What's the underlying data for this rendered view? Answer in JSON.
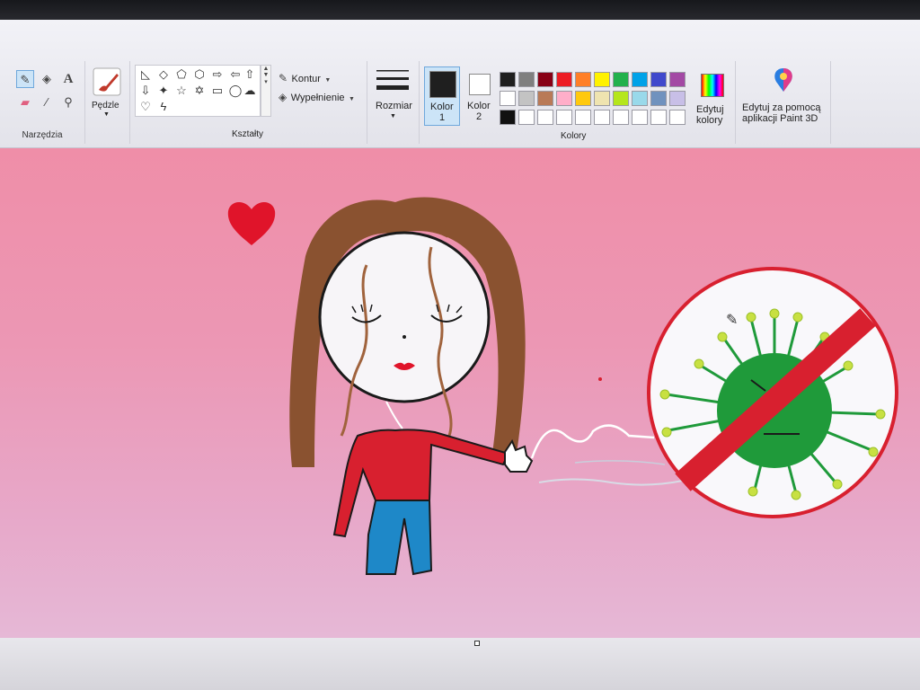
{
  "ribbon": {
    "tools_label": "Narzędzia",
    "brushes_label": "Pędzle",
    "shapes_label": "Kształty",
    "outline_label": "Kontur",
    "fill_label": "Wypełnienie",
    "size_label": "Rozmiar",
    "color1_label": "Kolor",
    "color1_num": "1",
    "color2_label": "Kolor",
    "color2_num": "2",
    "colors_label": "Kolory",
    "edit_colors_line1": "Edytuj",
    "edit_colors_line2": "kolory",
    "paint3d_line1": "Edytuj za pomocą",
    "paint3d_line2": "aplikacji Paint 3D",
    "text_tool_glyph": "A"
  },
  "palette": {
    "row1": [
      "#1f1f1f",
      "#7f7f7f",
      "#880015",
      "#ed1c24",
      "#ff7f27",
      "#fff200",
      "#22b14c",
      "#00a2e8",
      "#3f48cc",
      "#a349a4"
    ],
    "row2": [
      "#ffffff",
      "#c3c3c3",
      "#b97a57",
      "#ffaec9",
      "#ffc90e",
      "#efe4b0",
      "#b5e61d",
      "#99d9ea",
      "#7092be",
      "#c8bfe7"
    ],
    "row3": [
      "#111111",
      "#ffffff",
      "#ffffff",
      "#ffffff",
      "#ffffff",
      "#ffffff",
      "#ffffff",
      "#ffffff",
      "#ffffff",
      "#ffffff"
    ],
    "color1": "#1f1f1f",
    "color2": "#ffffff"
  },
  "icons": {
    "pencil": "pencil-icon",
    "fill": "fill-bucket-icon",
    "text": "text-icon",
    "eraser": "eraser-icon",
    "picker": "color-picker-icon",
    "magnifier": "magnifier-icon",
    "brush": "brush-icon",
    "paint3d": "paint3d-icon"
  },
  "drawing_colors": {
    "hair": "#8a5230",
    "sweater": "#d8202f",
    "pants": "#1e88c8",
    "virus": "#1f9a3a",
    "ban": "#d8202f",
    "heart": "#e0142a"
  }
}
